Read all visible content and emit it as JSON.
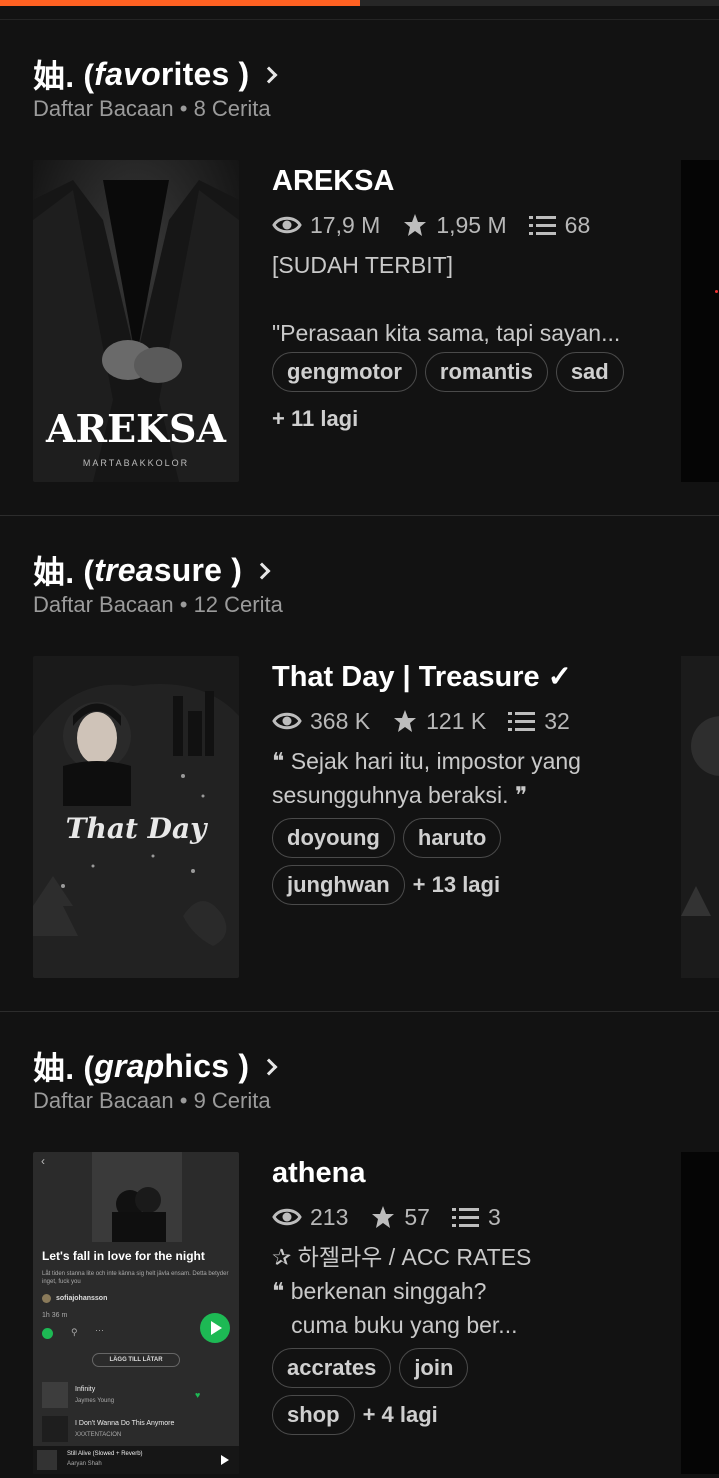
{
  "reading_progress": 0.5,
  "accent_color": "#ff6122",
  "lists": [
    {
      "title_prefix": "妯. ( ",
      "title_italic": "favo",
      "title_rest": "rites )",
      "subtitle": "Daftar Bacaan • 8 Cerita",
      "story": {
        "title": "AREKSA",
        "reads": "17,9 M",
        "votes": "1,95 M",
        "parts": "68",
        "desc_lines": [
          "[SUDAH TERBIT]",
          "",
          "\"Perasaan kita sama, tapi sayan..."
        ],
        "tags": [
          "gengmotor",
          "romantis",
          "sad"
        ],
        "more": "+ 11 lagi",
        "cover_title": "AREKSA",
        "cover_author": "MARTABAKKOLOR"
      }
    },
    {
      "title_prefix": "妯. ( ",
      "title_italic": "trea",
      "title_rest": "sure )",
      "subtitle": "Daftar Bacaan • 12 Cerita",
      "story": {
        "title": "That Day | Treasure ✓",
        "reads": "368 K",
        "votes": "121 K",
        "parts": "32",
        "desc_lines": [
          "❝ Sejak hari itu, impostor yang",
          "sesungguhnya beraksi. ❞"
        ],
        "tags": [
          "doyoung",
          "haruto",
          "junghwan"
        ],
        "more": "+ 13 lagi",
        "cover_title": "That Day"
      }
    },
    {
      "title_prefix": "妯. ( ",
      "title_italic": "grap",
      "title_rest": "hics )",
      "subtitle": "Daftar Bacaan • 9 Cerita",
      "story": {
        "title": "athena",
        "reads": "213",
        "votes": "57",
        "parts": "3",
        "desc_lines": [
          "✰ 하젤라우 / ACC RATES",
          "❝ berkenan singgah?",
          "   cuma buku yang ber..."
        ],
        "tags": [
          "accrates",
          "join",
          "shop"
        ],
        "more": "+ 4 lagi",
        "cover": {
          "headline": "Let's fall in love for the night",
          "lyric": "Låt tiden stanna lite och inte känna sig helt jävla ensam. Detta betyder inget, fuck you",
          "user": "sofiajohansson",
          "duration": "1h 36 m",
          "add_label": "LÄGG TILL LÅTAR",
          "tracks": [
            {
              "name": "Infinity",
              "artist": "Jaymes Young"
            },
            {
              "name": "I Don't Wanna Do This Anymore",
              "artist": "XXXTENTACION"
            }
          ],
          "now_playing": {
            "name": "Still Alive (Slowed + Reverb)",
            "artist": "Aaryan Shah"
          }
        }
      }
    }
  ]
}
